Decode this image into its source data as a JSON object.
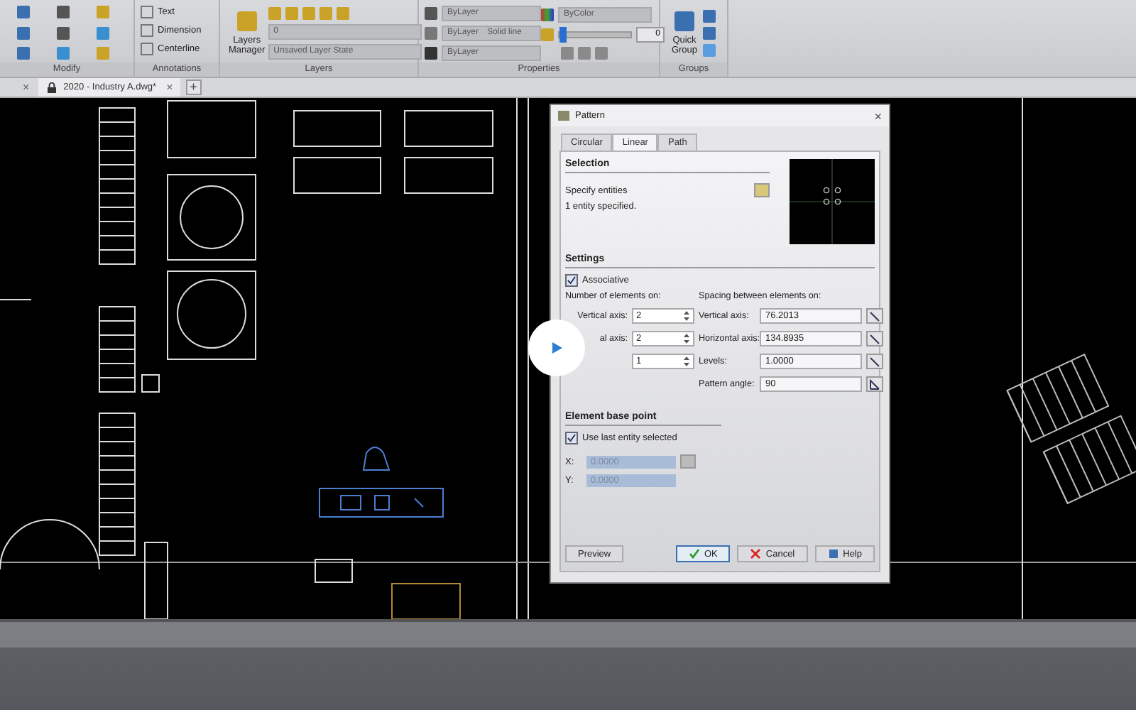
{
  "ribbon": {
    "modify": {
      "title": "Modify"
    },
    "annotations": {
      "title": "Annotations",
      "tools": [
        "Text",
        "Dimension",
        "Centerline"
      ]
    },
    "layers": {
      "title": "Layers",
      "manager_label": "Layers Manager",
      "layer_value": "0",
      "layer_state": "Unsaved Layer State"
    },
    "properties": {
      "title": "Properties",
      "color_value": "ByLayer",
      "linetype": "ByLayer",
      "linetype_name": "Solid line",
      "lineweight": "ByLayer",
      "plot_style": "ByColor",
      "transparency": {
        "value": "0",
        "level": 0
      }
    },
    "groups": {
      "title": "Groups",
      "quick_group_label": "Quick Group"
    }
  },
  "document_tabs": {
    "tabs": [
      {
        "label": "2020 - Industry A.dwg*",
        "selected": true
      }
    ],
    "close": "×",
    "add": "+"
  },
  "dialog": {
    "title": "Pattern",
    "close": "×",
    "tabs": [
      {
        "label": "Circular",
        "selected": false
      },
      {
        "label": "Linear",
        "selected": true
      },
      {
        "label": "Path",
        "selected": false
      }
    ],
    "selection": {
      "heading": "Selection",
      "prompt": "Specify entities",
      "status": "1 entity specified."
    },
    "settings": {
      "heading": "Settings",
      "associative": {
        "label": "Associative",
        "checked": true
      },
      "count_heading": "Number of elements on:",
      "spacing_heading": "Spacing between elements on:",
      "counts": [
        {
          "label": "Vertical axis:",
          "value": "2"
        },
        {
          "label": "al axis:",
          "value": "2"
        },
        {
          "value": "1"
        }
      ],
      "spacings": [
        {
          "label": "Vertical axis:",
          "value": "76.2013",
          "kind": "distance"
        },
        {
          "label": "Horizontal axis:",
          "value": "134.8935",
          "kind": "distance"
        },
        {
          "label": "Levels:",
          "value": "1.0000",
          "kind": "distance"
        },
        {
          "label": "Pattern angle:",
          "value": "90",
          "kind": "angle"
        }
      ]
    },
    "base_point": {
      "heading": "Element base point",
      "use_last": {
        "label": "Use last entity selected",
        "checked": true
      },
      "fields": [
        {
          "label": "X:",
          "value": "0.0000",
          "pick": true
        },
        {
          "label": "Y:",
          "value": "0.0000",
          "pick": false
        }
      ]
    },
    "buttons": [
      {
        "label": "Preview",
        "kind": "plain",
        "default": false
      },
      {
        "label": "OK",
        "kind": "ok",
        "default": true
      },
      {
        "label": "Cancel",
        "kind": "cancel",
        "default": false
      },
      {
        "label": "Help",
        "kind": "help",
        "default": false
      }
    ]
  }
}
